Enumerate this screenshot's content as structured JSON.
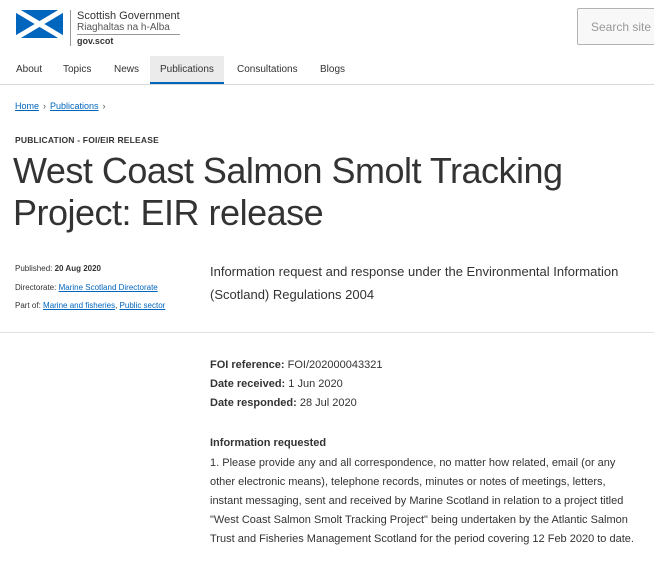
{
  "header": {
    "logo_line1": "Scottish Government",
    "logo_line2": "Riaghaltas na h-Alba",
    "logo_line3": "gov.scot",
    "search_placeholder": "Search site"
  },
  "nav": {
    "items": [
      {
        "label": "About"
      },
      {
        "label": "Topics"
      },
      {
        "label": "News"
      },
      {
        "label": "Publications",
        "active": true
      },
      {
        "label": "Consultations"
      },
      {
        "label": "Blogs"
      }
    ]
  },
  "breadcrumb": {
    "home": "Home",
    "publications": "Publications",
    "separator": "›"
  },
  "page": {
    "kicker": "PUBLICATION - FOI/EIR RELEASE",
    "title": "West Coast Salmon Smolt Tracking Project: EIR release",
    "published_label": "Published:",
    "published_value": "20 Aug 2020",
    "directorate_label": "Directorate:",
    "directorate_value": "Marine Scotland Directorate",
    "partof_label": "Part of:",
    "partof_link1": "Marine and fisheries",
    "partof_link2": "Public sector",
    "summary": "Information request and response under the Environmental Information (Scotland) Regulations 2004"
  },
  "foi": {
    "ref_label": "FOI reference:",
    "ref_value": "FOI/202000043321",
    "received_label": "Date received:",
    "received_value": "1 Jun 2020",
    "responded_label": "Date responded:",
    "responded_value": "28 Jul 2020"
  },
  "request": {
    "heading": "Information requested",
    "body": "1. Please provide any and all correspondence, no matter how related, email (or any other electronic means), telephone records, minutes or notes of meetings, letters, instant messaging, sent and received by Marine Scotland in relation to a project titled \"West Coast Salmon Smolt Tracking Project\" being undertaken by the Atlantic Salmon Trust and Fisheries Management Scotland for the period covering 12 Feb 2020 to date."
  },
  "colors": {
    "brand_blue": "#0065bd",
    "text": "#333333"
  }
}
